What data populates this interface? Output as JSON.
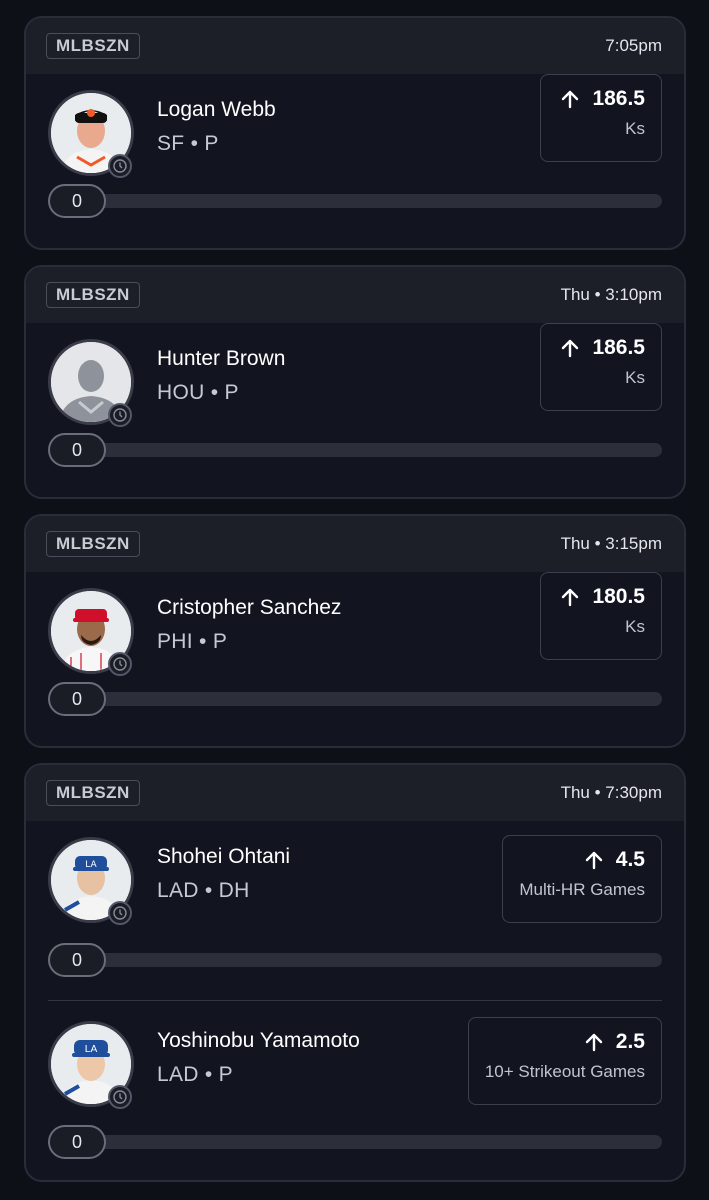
{
  "cards": [
    {
      "tag": "MLBSZN",
      "time": "7:05pm",
      "players": [
        {
          "name": "Logan Webb",
          "meta": "SF • P",
          "stat_value": "186.5",
          "stat_unit": "Ks",
          "progress": "0",
          "avatar_color": "#f05a28"
        }
      ]
    },
    {
      "tag": "MLBSZN",
      "time": "Thu • 3:10pm",
      "players": [
        {
          "name": "Hunter Brown",
          "meta": "HOU • P",
          "stat_value": "186.5",
          "stat_unit": "Ks",
          "progress": "0",
          "avatar_color": "#9aa0a8"
        }
      ]
    },
    {
      "tag": "MLBSZN",
      "time": "Thu • 3:15pm",
      "players": [
        {
          "name": "Cristopher Sanchez",
          "meta": "PHI • P",
          "stat_value": "180.5",
          "stat_unit": "Ks",
          "progress": "0",
          "avatar_color": "#d0102b"
        }
      ]
    },
    {
      "tag": "MLBSZN",
      "time": "Thu • 7:30pm",
      "players": [
        {
          "name": "Shohei Ohtani",
          "meta": "LAD • DH",
          "stat_value": "4.5",
          "stat_unit": "Multi-HR Games",
          "progress": "0",
          "avatar_color": "#1f4e9c"
        },
        {
          "name": "Yoshinobu Yamamoto",
          "meta": "LAD • P",
          "stat_value": "2.5",
          "stat_unit": "10+ Strikeout Games",
          "progress": "0",
          "avatar_color": "#1f4e9c"
        }
      ]
    }
  ],
  "icons": {
    "arrow": "arrow-up-icon",
    "clock": "clock-icon"
  },
  "colors": {
    "background": "#0e1018",
    "card": "#121520",
    "header": "#1c1e28",
    "track": "#2c2f3a"
  }
}
